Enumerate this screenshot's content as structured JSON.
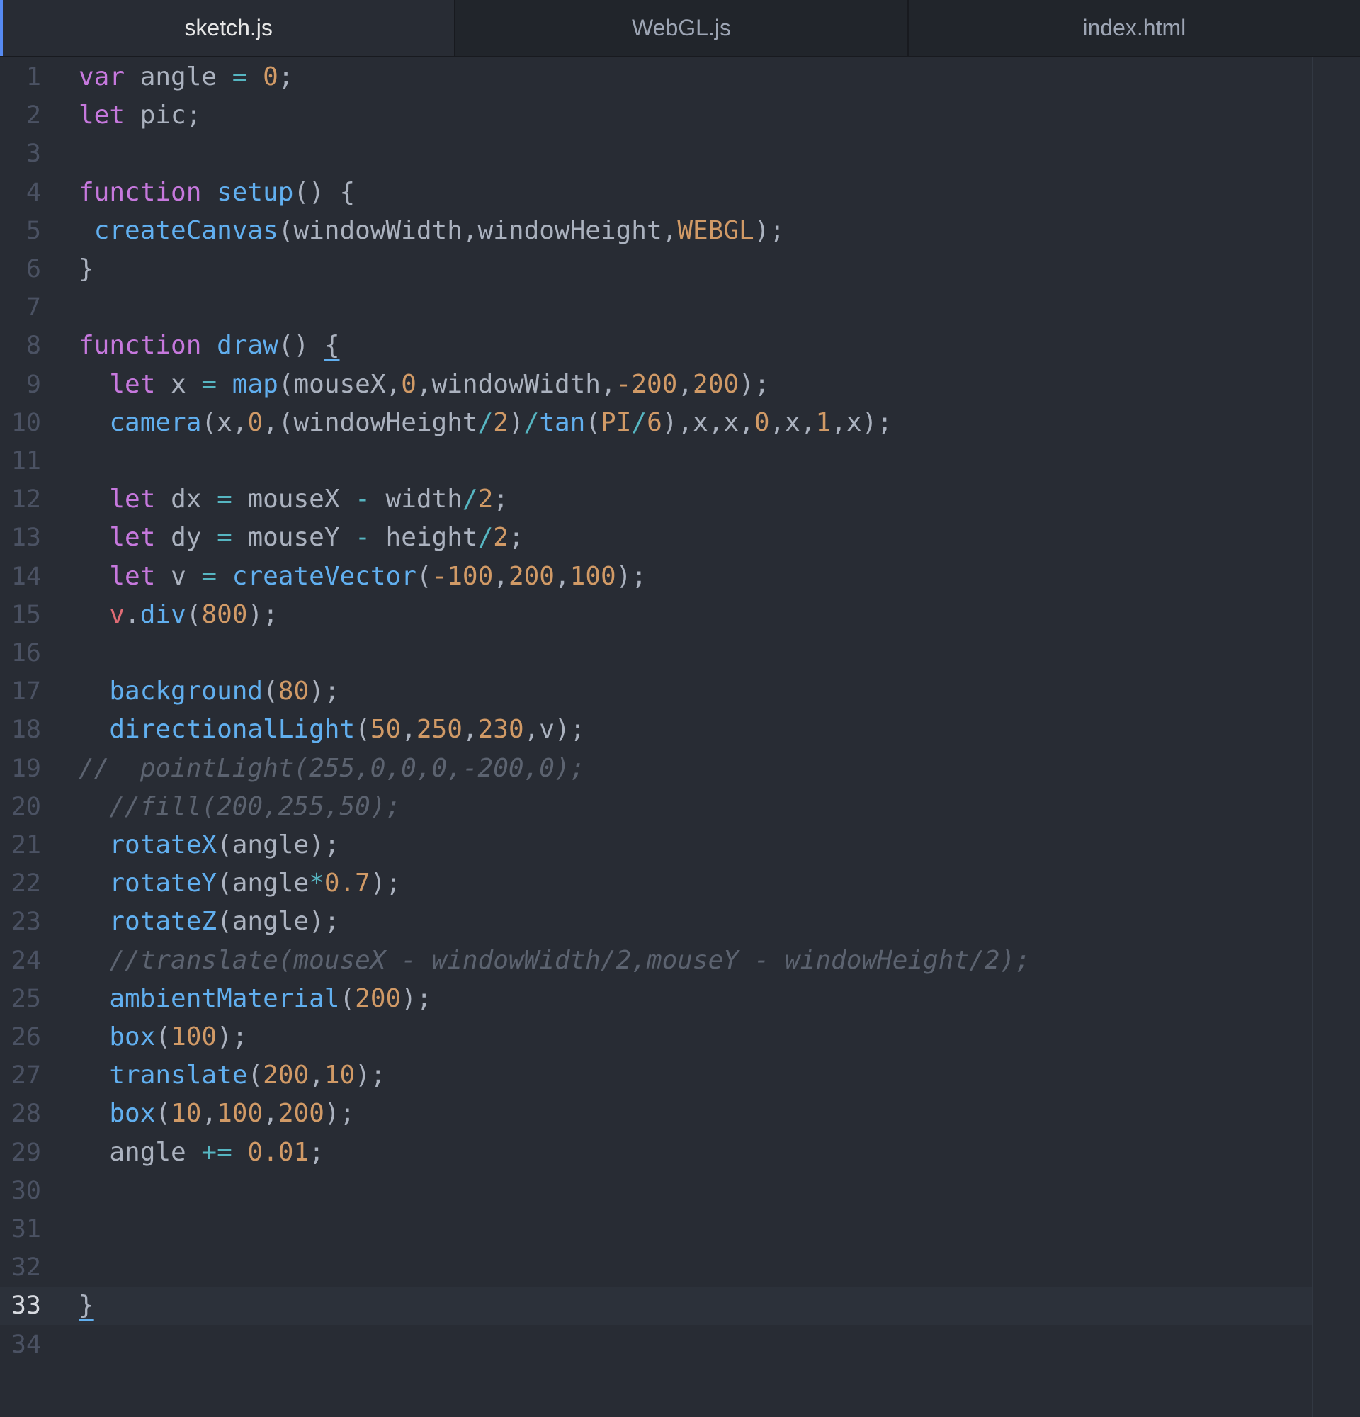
{
  "tabs": [
    {
      "label": "sketch.js",
      "active": true
    },
    {
      "label": "WebGL.js",
      "active": false
    },
    {
      "label": "index.html",
      "active": false
    }
  ],
  "editor": {
    "current_line": 33,
    "lines": [
      [
        [
          "k",
          "var "
        ],
        [
          "p",
          "angle "
        ],
        [
          "o",
          "= "
        ],
        [
          "n",
          "0"
        ],
        [
          "p",
          ";"
        ]
      ],
      [
        [
          "k",
          "let "
        ],
        [
          "p",
          "pic;"
        ]
      ],
      [],
      [
        [
          "k",
          "function "
        ],
        [
          "f",
          "setup"
        ],
        [
          "p",
          "() {"
        ]
      ],
      [
        [
          "p",
          " "
        ],
        [
          "f",
          "createCanvas"
        ],
        [
          "p",
          "(windowWidth,windowHeight,"
        ],
        [
          "n",
          "WEBGL"
        ],
        [
          "p",
          ");"
        ]
      ],
      [
        [
          "p",
          "}"
        ]
      ],
      [],
      [
        [
          "k",
          "function "
        ],
        [
          "f",
          "draw"
        ],
        [
          "p",
          "() "
        ],
        [
          "pu",
          "{"
        ]
      ],
      [
        [
          "p",
          "  "
        ],
        [
          "k",
          "let "
        ],
        [
          "p",
          "x "
        ],
        [
          "o",
          "= "
        ],
        [
          "f",
          "map"
        ],
        [
          "p",
          "(mouseX,"
        ],
        [
          "n",
          "0"
        ],
        [
          "p",
          ",windowWidth,"
        ],
        [
          "n",
          "-200"
        ],
        [
          "p",
          ","
        ],
        [
          "n",
          "200"
        ],
        [
          "p",
          ");"
        ]
      ],
      [
        [
          "p",
          "  "
        ],
        [
          "f",
          "camera"
        ],
        [
          "p",
          "(x,"
        ],
        [
          "n",
          "0"
        ],
        [
          "p",
          ",(windowHeight"
        ],
        [
          "o",
          "/"
        ],
        [
          "n",
          "2"
        ],
        [
          "p",
          ")"
        ],
        [
          "o",
          "/"
        ],
        [
          "f",
          "tan"
        ],
        [
          "p",
          "("
        ],
        [
          "n",
          "PI"
        ],
        [
          "o",
          "/"
        ],
        [
          "n",
          "6"
        ],
        [
          "p",
          "),x,x,"
        ],
        [
          "n",
          "0"
        ],
        [
          "p",
          ",x,"
        ],
        [
          "n",
          "1"
        ],
        [
          "p",
          ",x);"
        ]
      ],
      [],
      [
        [
          "p",
          "  "
        ],
        [
          "k",
          "let "
        ],
        [
          "p",
          "dx "
        ],
        [
          "o",
          "= "
        ],
        [
          "p",
          "mouseX "
        ],
        [
          "o",
          "- "
        ],
        [
          "p",
          "width"
        ],
        [
          "o",
          "/"
        ],
        [
          "n",
          "2"
        ],
        [
          "p",
          ";"
        ]
      ],
      [
        [
          "p",
          "  "
        ],
        [
          "k",
          "let "
        ],
        [
          "p",
          "dy "
        ],
        [
          "o",
          "= "
        ],
        [
          "p",
          "mouseY "
        ],
        [
          "o",
          "- "
        ],
        [
          "p",
          "height"
        ],
        [
          "o",
          "/"
        ],
        [
          "n",
          "2"
        ],
        [
          "p",
          ";"
        ]
      ],
      [
        [
          "p",
          "  "
        ],
        [
          "k",
          "let "
        ],
        [
          "p",
          "v "
        ],
        [
          "o",
          "= "
        ],
        [
          "f",
          "createVector"
        ],
        [
          "p",
          "("
        ],
        [
          "n",
          "-100"
        ],
        [
          "p",
          ","
        ],
        [
          "n",
          "200"
        ],
        [
          "p",
          ","
        ],
        [
          "n",
          "100"
        ],
        [
          "p",
          ");"
        ]
      ],
      [
        [
          "p",
          "  "
        ],
        [
          "v",
          "v"
        ],
        [
          "p",
          "."
        ],
        [
          "f",
          "div"
        ],
        [
          "p",
          "("
        ],
        [
          "n",
          "800"
        ],
        [
          "p",
          ");"
        ]
      ],
      [],
      [
        [
          "p",
          "  "
        ],
        [
          "f",
          "background"
        ],
        [
          "p",
          "("
        ],
        [
          "n",
          "80"
        ],
        [
          "p",
          ");"
        ]
      ],
      [
        [
          "p",
          "  "
        ],
        [
          "f",
          "directionalLight"
        ],
        [
          "p",
          "("
        ],
        [
          "n",
          "50"
        ],
        [
          "p",
          ","
        ],
        [
          "n",
          "250"
        ],
        [
          "p",
          ","
        ],
        [
          "n",
          "230"
        ],
        [
          "p",
          ",v);"
        ]
      ],
      [
        [
          "c",
          "//  pointLight(255,0,0,0,-200,0);"
        ]
      ],
      [
        [
          "c",
          "  //fill(200,255,50);"
        ]
      ],
      [
        [
          "p",
          "  "
        ],
        [
          "f",
          "rotateX"
        ],
        [
          "p",
          "(angle);"
        ]
      ],
      [
        [
          "p",
          "  "
        ],
        [
          "f",
          "rotateY"
        ],
        [
          "p",
          "(angle"
        ],
        [
          "o",
          "*"
        ],
        [
          "n",
          "0.7"
        ],
        [
          "p",
          ");"
        ]
      ],
      [
        [
          "p",
          "  "
        ],
        [
          "f",
          "rotateZ"
        ],
        [
          "p",
          "(angle);"
        ]
      ],
      [
        [
          "c",
          "  //translate(mouseX - windowWidth/2,mouseY - windowHeight/2);"
        ]
      ],
      [
        [
          "p",
          "  "
        ],
        [
          "f",
          "ambientMaterial"
        ],
        [
          "p",
          "("
        ],
        [
          "n",
          "200"
        ],
        [
          "p",
          ");"
        ]
      ],
      [
        [
          "p",
          "  "
        ],
        [
          "f",
          "box"
        ],
        [
          "p",
          "("
        ],
        [
          "n",
          "100"
        ],
        [
          "p",
          ");"
        ]
      ],
      [
        [
          "p",
          "  "
        ],
        [
          "f",
          "translate"
        ],
        [
          "p",
          "("
        ],
        [
          "n",
          "200"
        ],
        [
          "p",
          ","
        ],
        [
          "n",
          "10"
        ],
        [
          "p",
          ");"
        ]
      ],
      [
        [
          "p",
          "  "
        ],
        [
          "f",
          "box"
        ],
        [
          "p",
          "("
        ],
        [
          "n",
          "10"
        ],
        [
          "p",
          ","
        ],
        [
          "n",
          "100"
        ],
        [
          "p",
          ","
        ],
        [
          "n",
          "200"
        ],
        [
          "p",
          ");"
        ]
      ],
      [
        [
          "p",
          "  angle "
        ],
        [
          "o",
          "+= "
        ],
        [
          "n",
          "0.01"
        ],
        [
          "p",
          ";"
        ]
      ],
      [],
      [],
      [],
      [
        [
          "pu",
          "}"
        ]
      ],
      []
    ]
  }
}
